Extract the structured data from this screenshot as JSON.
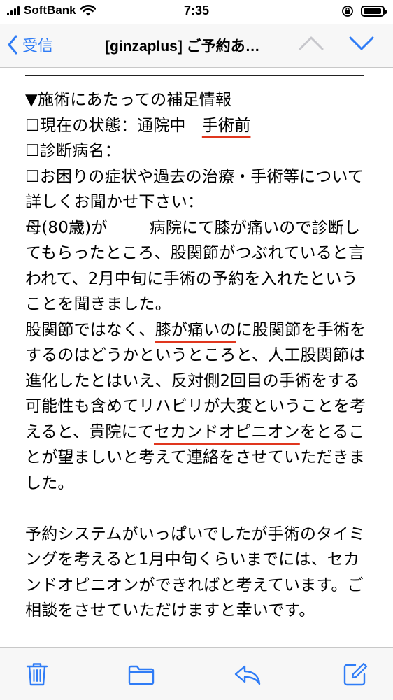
{
  "status_bar": {
    "carrier": "SoftBank",
    "time": "7:35",
    "battery_level": 0.95
  },
  "nav": {
    "back_label": "受信",
    "subject": "[ginzaplus] ご予約あ…",
    "icons": [
      "chevron-left-icon",
      "chevron-up-icon",
      "chevron-down-icon"
    ]
  },
  "email": {
    "section_heading": "▼施術にあたっての補足情報",
    "status_label": "☐現在の状態：通院中",
    "status_value": "手術前",
    "diagnosis_label": "☐診断病名：",
    "symptoms_question": "☐お困りの症状や過去の治療・手術等について詳しくお聞かせ下さい：",
    "para1_a": "母(80歳)が",
    "para1_b": "病院にて膝が痛いので診断してもらったところ、股関節がつぶれていると言われて、2月中旬に手術の予約を入れたということを聞きました。",
    "para2_a": "股関節ではなく、",
    "para2_u1": "膝が痛いの",
    "para2_b": "に股関節を手術をするのはどうかというところと、人工股関節は進化したとはいえ、反対側2回目の手術をする可能性も含めてリハビリが大変ということを考えると、貴院にて",
    "para2_u2": "セカンドオピニオン",
    "para2_c": "をとることが望ましいと考えて連絡をさせていただきました。",
    "para3": "予約システムがいっぱいでしたが手術のタイミングを考えると1月中旬くらいまでには、セカンドオピニオンができればと考えています。ご相談をさせていただけますと幸いです。"
  },
  "toolbar": {
    "icons": [
      "trash-icon",
      "folder-icon",
      "reply-icon",
      "compose-icon"
    ]
  },
  "colors": {
    "accent": "#2f7cf6",
    "underline": "#e0361e"
  }
}
